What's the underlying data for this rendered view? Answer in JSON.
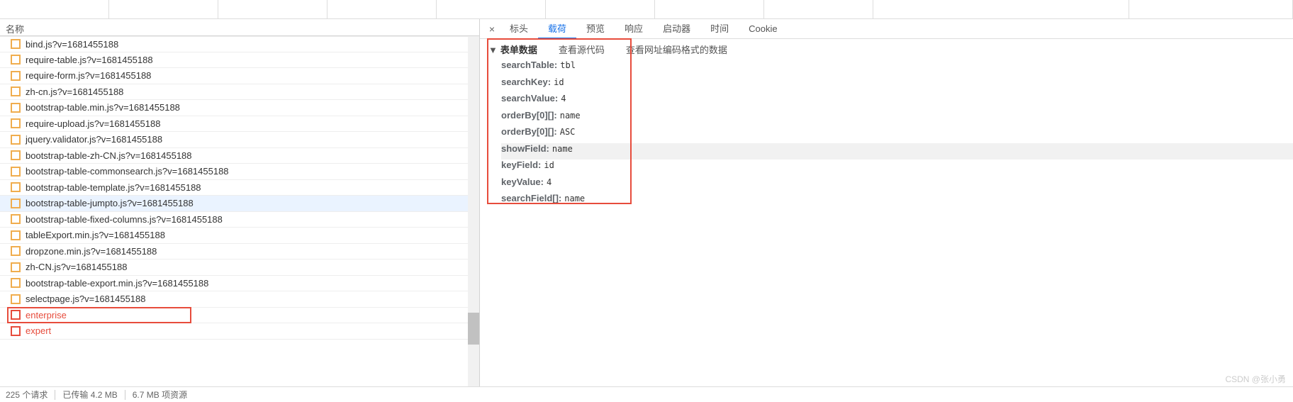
{
  "header": {
    "name_label": "名称"
  },
  "requests": [
    {
      "name": "bind.js?v=1681455188",
      "type": "js",
      "partial": true
    },
    {
      "name": "require-table.js?v=1681455188",
      "type": "js"
    },
    {
      "name": "require-form.js?v=1681455188",
      "type": "js"
    },
    {
      "name": "zh-cn.js?v=1681455188",
      "type": "js"
    },
    {
      "name": "bootstrap-table.min.js?v=1681455188",
      "type": "js"
    },
    {
      "name": "require-upload.js?v=1681455188",
      "type": "js"
    },
    {
      "name": "jquery.validator.js?v=1681455188",
      "type": "js"
    },
    {
      "name": "bootstrap-table-zh-CN.js?v=1681455188",
      "type": "js"
    },
    {
      "name": "bootstrap-table-commonsearch.js?v=1681455188",
      "type": "js"
    },
    {
      "name": "bootstrap-table-template.js?v=1681455188",
      "type": "js"
    },
    {
      "name": "bootstrap-table-jumpto.js?v=1681455188",
      "type": "js",
      "selected": true
    },
    {
      "name": "bootstrap-table-fixed-columns.js?v=1681455188",
      "type": "js"
    },
    {
      "name": "tableExport.min.js?v=1681455188",
      "type": "js"
    },
    {
      "name": "dropzone.min.js?v=1681455188",
      "type": "js"
    },
    {
      "name": "zh-CN.js?v=1681455188",
      "type": "js"
    },
    {
      "name": "bootstrap-table-export.min.js?v=1681455188",
      "type": "js"
    },
    {
      "name": "selectpage.js?v=1681455188",
      "type": "js"
    },
    {
      "name": "enterprise",
      "type": "xhr",
      "highlighted": true
    },
    {
      "name": "expert",
      "type": "xhr"
    }
  ],
  "detail_tabs": {
    "close": "×",
    "items": [
      "标头",
      "载荷",
      "预览",
      "响应",
      "启动器",
      "时间",
      "Cookie"
    ],
    "active_index": 1
  },
  "payload_headers": {
    "arrow": "▼",
    "items": [
      "表单数据",
      "查看源代码",
      "查看网址编码格式的数据"
    ]
  },
  "form_data": [
    {
      "key": "searchTable:",
      "value": "tbl"
    },
    {
      "key": "searchKey:",
      "value": "id"
    },
    {
      "key": "searchValue:",
      "value": "4"
    },
    {
      "key": "orderBy[0][]:",
      "value": "name"
    },
    {
      "key": "orderBy[0][]:",
      "value": "ASC"
    },
    {
      "key": "showField:",
      "value": "name",
      "selected": true
    },
    {
      "key": "keyField:",
      "value": "id"
    },
    {
      "key": "keyValue:",
      "value": "4"
    },
    {
      "key": "searchField[]:",
      "value": "name"
    }
  ],
  "status": {
    "requests": "225 个请求",
    "transferred": "已传输 4.2 MB",
    "resources": "6.7 MB 项资源"
  },
  "watermark": "CSDN @张小勇"
}
